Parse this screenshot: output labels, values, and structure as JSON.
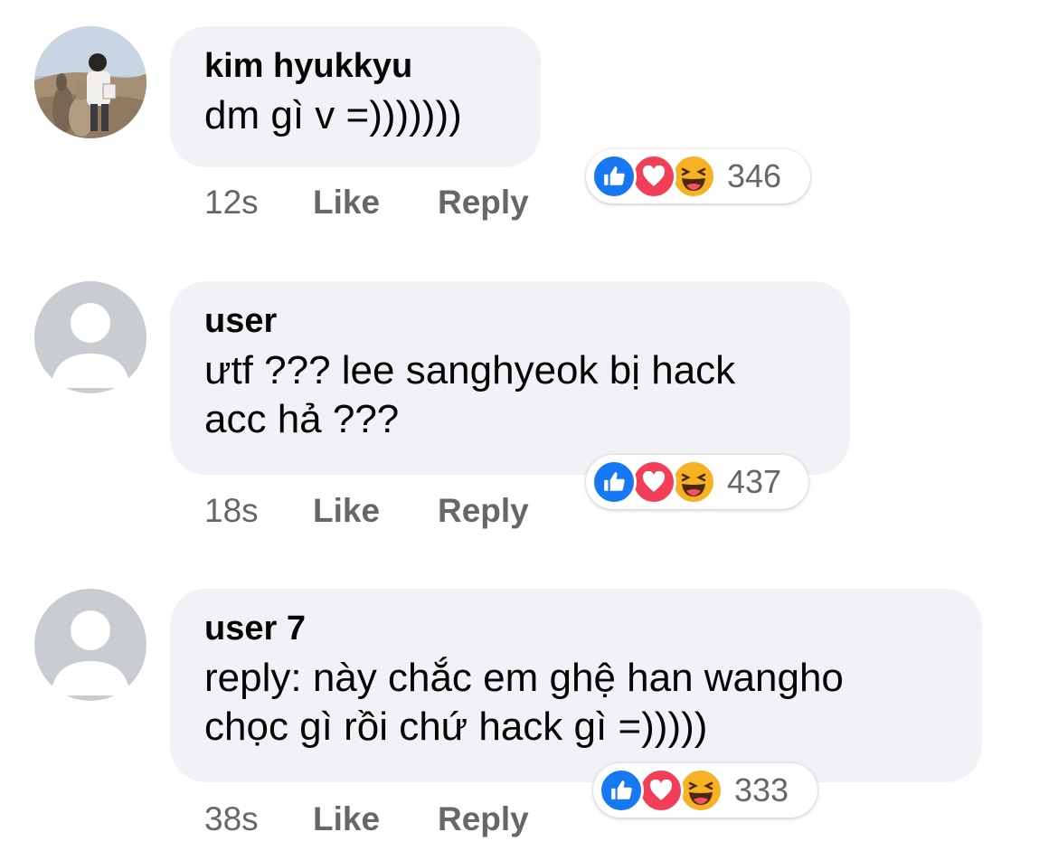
{
  "comments": [
    {
      "author": "kim hyukkyu",
      "text": "dm gì v =)))))))",
      "time": "12s",
      "like_label": "Like",
      "reply_label": "Reply",
      "reaction_count": "346",
      "avatar": "photo-avatar"
    },
    {
      "author": "user",
      "text": "ưtf ??? lee sanghyeok bị hack\nacc hả ???",
      "time": "18s",
      "like_label": "Like",
      "reply_label": "Reply",
      "reaction_count": "437",
      "avatar": "default-avatar"
    },
    {
      "author": "user 7",
      "text": "reply: này chắc em ghệ han wangho\nchọc gì rồi chứ hack gì =)))))",
      "time": "38s",
      "like_label": "Like",
      "reply_label": "Reply",
      "reaction_count": "333",
      "avatar": "default-avatar"
    }
  ],
  "reaction_icons": [
    "like-icon",
    "love-icon",
    "haha-icon"
  ],
  "colors": {
    "bubble": "#f0f2f5",
    "meta_text": "#65676b",
    "like_blue": "#1877f2",
    "love_red": "#f33e58",
    "haha_yellow": "#f7b125"
  }
}
